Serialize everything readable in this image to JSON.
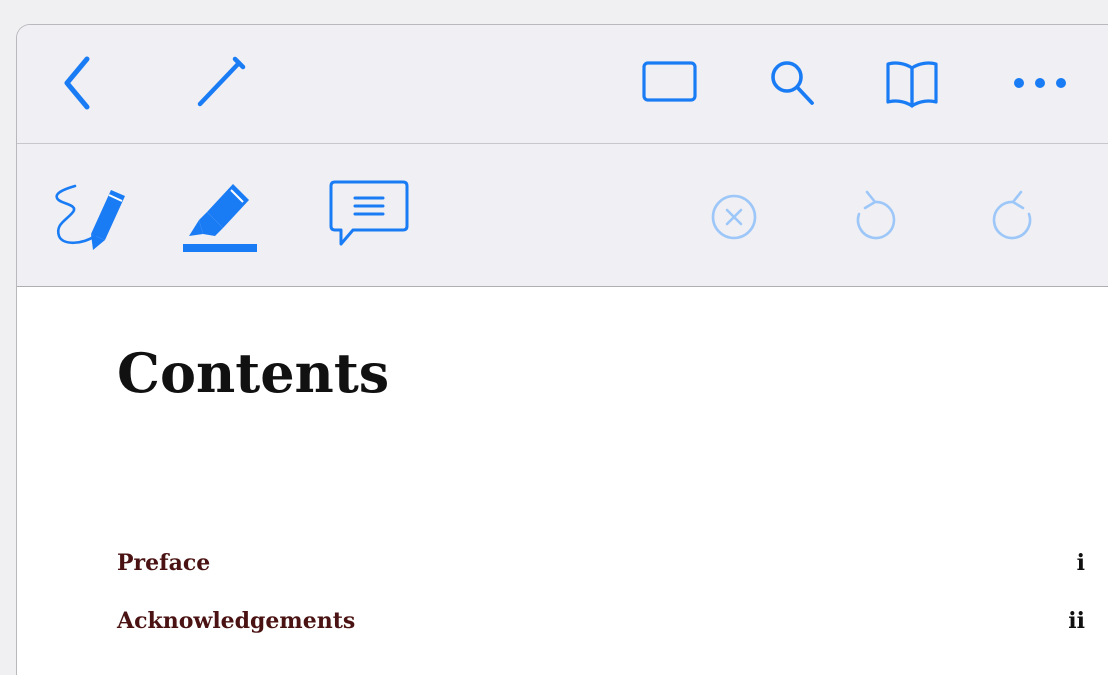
{
  "colors": {
    "accent": "#1a7cf5",
    "accent_disabled": "#9cc7f8",
    "toolbar_bg": "#efeff4",
    "toc_link": "#4a1212",
    "text": "#111111"
  },
  "top_toolbar": {
    "left_icons": [
      "back-chevron-icon",
      "pencil-icon"
    ],
    "right_icons": [
      "page-view-rectangle-icon",
      "search-icon",
      "book-icon",
      "more-ellipsis-icon"
    ]
  },
  "annotation_toolbar": {
    "tools": [
      "freehand-pen-icon",
      "highlighter-icon",
      "comment-note-icon"
    ],
    "actions": [
      "clear-icon",
      "undo-icon",
      "redo-icon"
    ]
  },
  "document": {
    "title": "Contents",
    "toc": [
      {
        "label": "Preface",
        "page": "i"
      },
      {
        "label": "Acknowledgements",
        "page": "ii"
      }
    ]
  }
}
